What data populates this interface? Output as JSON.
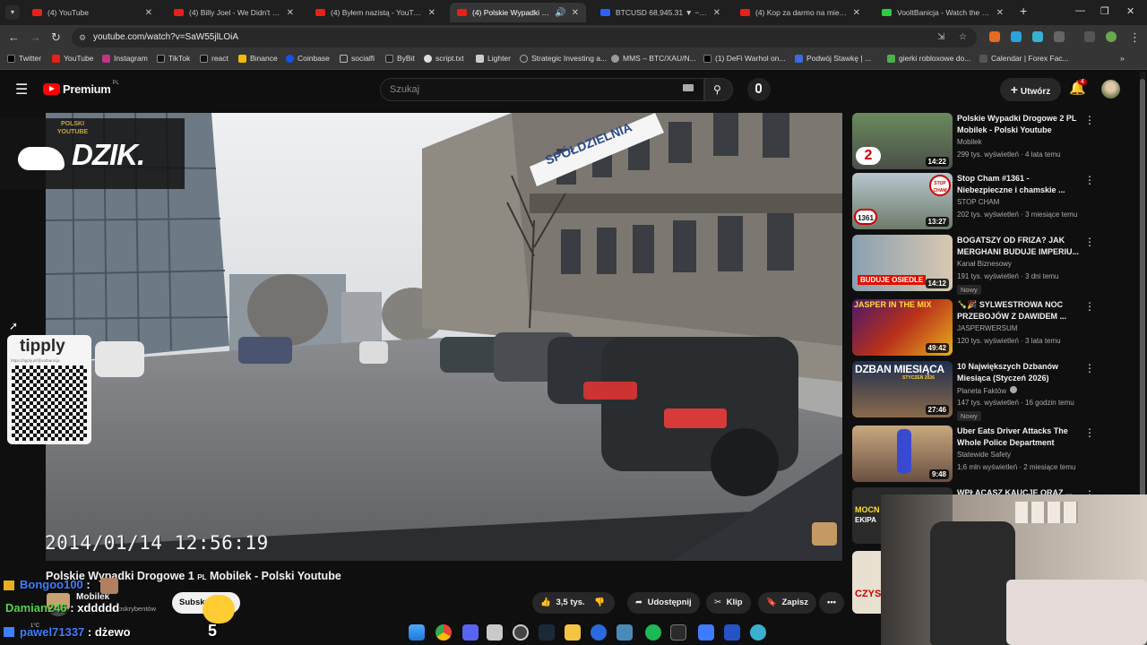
{
  "browser": {
    "tabs": [
      {
        "title": "(4) YouTube",
        "favicon": "youtube-icon",
        "active": false
      },
      {
        "title": "(4) Billy Joel - We Didn't Start The Fire",
        "favicon": "youtube-icon",
        "active": false
      },
      {
        "title": "(4) Byłem nazistą - YouTube",
        "favicon": "youtube-icon",
        "active": false
      },
      {
        "title": "(4) Polskie Wypadki Drogowe",
        "favicon": "youtube-icon",
        "active": true
      },
      {
        "title": "BTCUSD 68,945.31 ▼ −2.13% B",
        "favicon": "tradingview-icon",
        "active": false
      },
      {
        "title": "(4) Kop za darmo na miescie #",
        "favicon": "youtube-icon",
        "active": false
      },
      {
        "title": "VooltBanicja - Watch the VOD",
        "favicon": "kick-icon",
        "active": false
      }
    ],
    "url": "youtube.com/watch?v=SaW55jlLOiA",
    "bookmarks": [
      "Twitter",
      "YouTube",
      "Instagram",
      "TikTok",
      "react",
      "Binance",
      "Coinbase",
      "socialfi",
      "ByBit",
      "script.txt",
      "Lighter",
      "Strategic Investing a...",
      "MMS – BTC/XAU/N...",
      "(1) DeFi Warhol on...",
      "Podwój Stawkę | ...",
      "gierki robloxowe do...",
      "Calendar | Forex Fac..."
    ]
  },
  "youtube": {
    "logo_text": "Premium",
    "logo_region": "PL",
    "search_placeholder": "Szukaj",
    "create_label": "Utwórz",
    "notification_count": "4"
  },
  "video": {
    "timestamp": "2014/01/14 12:56:19",
    "sign_text": "SPÓŁDZIELNIA",
    "title": "Polskie Wypadki Drogowe 1",
    "title_tag": "PL",
    "title_suffix": "Mobilek - Polski Youtube",
    "channel": "Mobilek",
    "subscribers": "subskrybentów",
    "subscribe_label": "Subskrybuj"
  },
  "actions": {
    "like_count": "3,5 tys.",
    "share_label": "Udostępnij",
    "clip_label": "Klip",
    "save_label": "Zapisz"
  },
  "overlays": {
    "dzik_text": "DZIK.",
    "dzik_sub": "POLSKI YOUTUBE",
    "tippy_text": "tipply",
    "tippy_url": "https://tipply.pl/@votbanicja"
  },
  "recommendations": [
    {
      "title": "Polskie Wypadki Drogowe 2 PL Mobilek - Polski Youtube",
      "channel": "Mobilek",
      "meta": "299 tys. wyświetleń · 4 lata temu",
      "duration": "14:22",
      "badge": ""
    },
    {
      "title": "Stop Cham #1361 - Niebezpieczne i chamskie ...",
      "channel": "STOP CHAM",
      "meta": "202 tys. wyświetleń · 3 miesiące temu",
      "duration": "13:27",
      "badge": ""
    },
    {
      "title": "BOGATSZY OD FRIZA? JAK MERGHANI BUDUJE IMPERIU...",
      "channel": "Kanał Biznesowy",
      "meta": "191 tys. wyświetleń · 3 dni temu",
      "duration": "14:12",
      "badge": "Nowy"
    },
    {
      "title": "🍾🎉 SYLWESTROWA NOC PRZEBOJÓW Z DAWIDEM ...",
      "channel": "JASPERWERSUM",
      "meta": "120 tys. wyświetleń · 3 lata temu",
      "duration": "49:42",
      "badge": ""
    },
    {
      "title": "10 Największych Dzbanów Miesiąca (Styczeń 2026)",
      "channel": "Planeta Faktów",
      "meta": "147 tys. wyświetleń · 16 godzin temu",
      "duration": "27:46",
      "badge": "Nowy"
    },
    {
      "title": "Uber Eats Driver Attacks The Whole Police Department",
      "channel": "Statewide Safety",
      "meta": "1,6 mln wyświetleń · 2 miesiące temu",
      "duration": "9:48",
      "badge": ""
    },
    {
      "title": "WPŁACASZ KAUCJE ORAZ ...",
      "channel": "",
      "meta": "",
      "duration": "",
      "badge": ""
    }
  ],
  "thumbnail_text": {
    "t1": "2",
    "t2": "1361",
    "t2_sign": "STOP CHAM",
    "t3": "BUDUJE OSIEDLE",
    "t4": "JASPER IN THE MIX",
    "t5": "DZBAN MIESIĄCA",
    "t5_sub": "STYCZEŃ 2026",
    "t7a": "MOCN",
    "t7b": "EKIPA",
    "t8": "CZYS"
  },
  "chat": [
    {
      "user": "Bongoo100",
      "text": ":",
      "color": "#3f7fff"
    },
    {
      "user": "Damian246",
      "text": ": xddddd",
      "color": "#54d64a"
    },
    {
      "user": "pawel71337",
      "text": ": dżewo",
      "color": "#3f7fff"
    }
  ],
  "misc": {
    "chat_badge_number": "5",
    "temperature": "1°C"
  }
}
